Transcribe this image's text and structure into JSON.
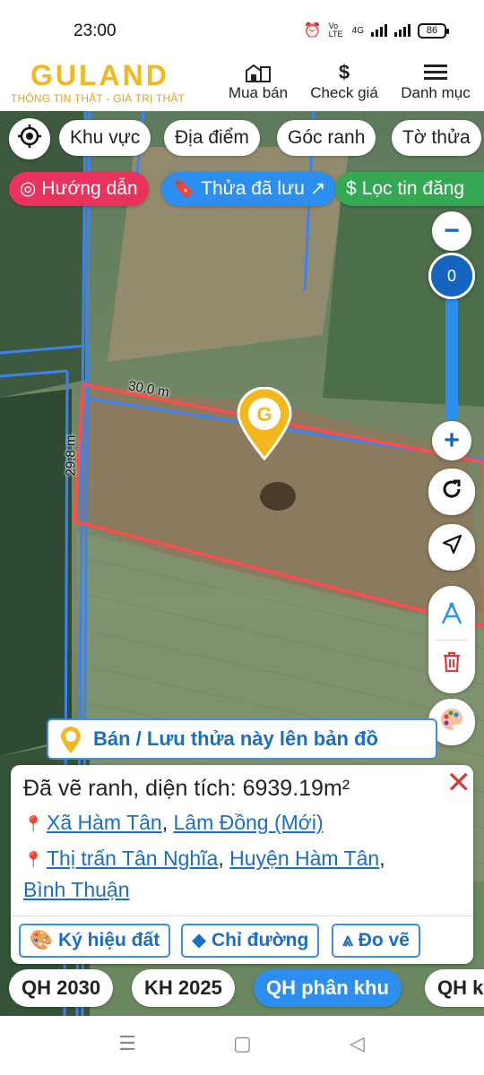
{
  "status": {
    "time": "23:00",
    "battery": "86",
    "network": "4G",
    "volte": "Vo LTE"
  },
  "header": {
    "logo_text": "GULAND",
    "tagline": "THÔNG TIN THẬT - GIÁ TRỊ THẬT",
    "nav": [
      {
        "label": "Mua bán",
        "icon": "building-icon"
      },
      {
        "label": "Check giá",
        "icon": "dollar-icon"
      },
      {
        "label": "Danh mục",
        "icon": "menu-icon"
      }
    ]
  },
  "filters": {
    "row1": [
      "Khu vực",
      "Địa điểm",
      "Góc ranh",
      "Tờ thửa"
    ],
    "guide": "Hướng dẫn",
    "saved": "Thửa đã lưu",
    "filter": "Lọc tin đăng"
  },
  "map": {
    "zoom_value": "0",
    "dim_top": "30.0 m",
    "dim_left": "29.8 m",
    "colors": {
      "boundary": "#ff4d4d",
      "road": "#3b82f6",
      "pin": "#f3b81e"
    }
  },
  "save_bar": {
    "label": "Bán / Lưu thửa này lên bản đồ"
  },
  "info": {
    "title": "Đã vẽ ranh, diện tích: 6939.19m²",
    "location_new": [
      "Xã Hàm Tân",
      "Lâm Đồng (Mới)"
    ],
    "location_old": [
      "Thị trấn Tân Nghĩa",
      "Huyện Hàm Tân",
      "Bình Thuận"
    ],
    "buttons": [
      "Ký hiệu đất",
      "Chỉ đường",
      "Đo vẽ"
    ]
  },
  "layers": [
    "QH 2030",
    "KH 2025",
    "QH phân khu",
    "QH k"
  ]
}
